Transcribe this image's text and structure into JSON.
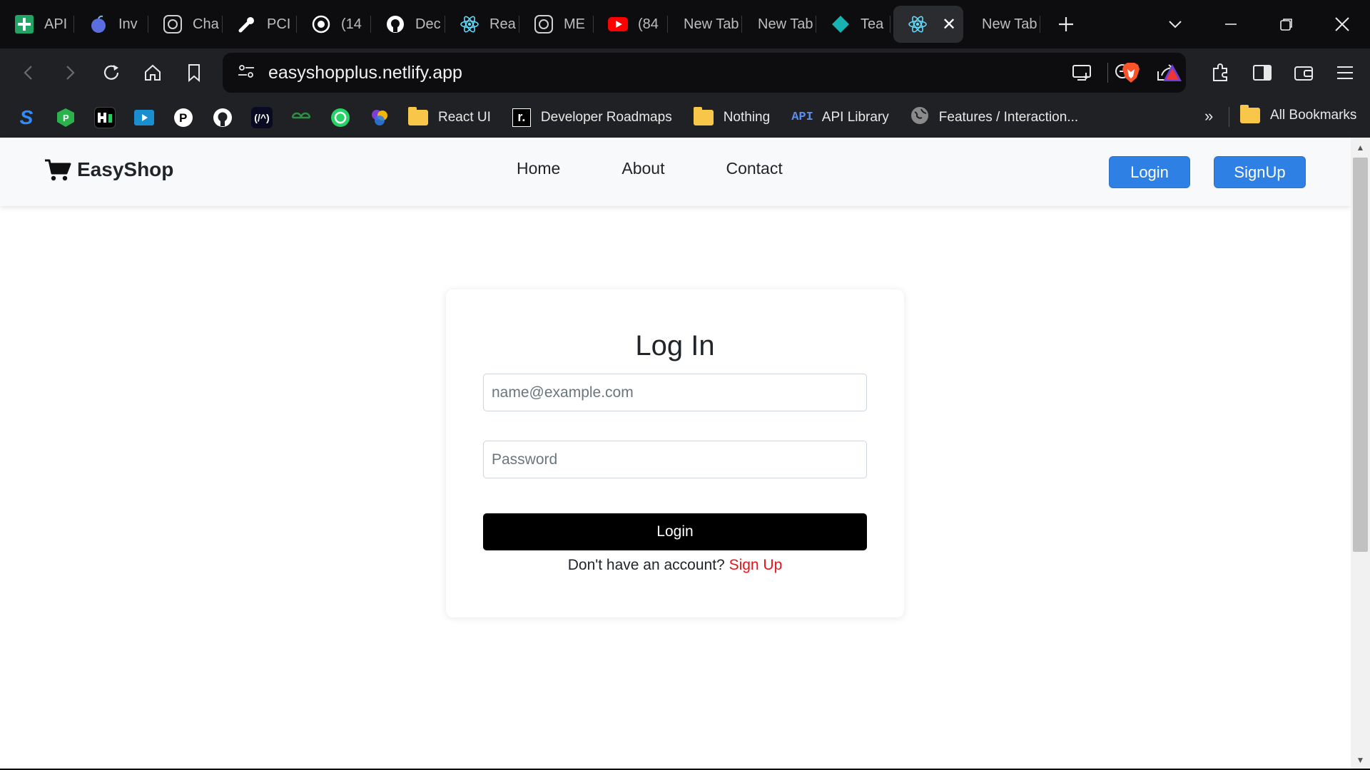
{
  "tabs": [
    {
      "title": "API",
      "icon": "green-plus-icon"
    },
    {
      "title": "Inv",
      "icon": "apple-icon"
    },
    {
      "title": "Cha",
      "icon": "chatgpt-icon"
    },
    {
      "title": "PCI",
      "icon": "postman-icon"
    },
    {
      "title": "(14",
      "icon": "whatsapp-icon"
    },
    {
      "title": "Dec",
      "icon": "github-icon"
    },
    {
      "title": "Rea",
      "icon": "react-icon"
    },
    {
      "title": "ME",
      "icon": "chatgpt-icon"
    },
    {
      "title": "(84",
      "icon": "youtube-icon"
    },
    {
      "title": "New Tab",
      "icon": ""
    },
    {
      "title": "New Tab",
      "icon": ""
    },
    {
      "title": "Tea",
      "icon": "diamond-icon"
    },
    {
      "title": "",
      "icon": "react-icon",
      "active": true
    },
    {
      "title": "New Tab",
      "icon": ""
    }
  ],
  "toolbar": {
    "url": "easyshopplus.netlify.app"
  },
  "bookmarks": {
    "items": [
      {
        "label": "React UI",
        "type": "folder"
      },
      {
        "label": "Developer Roadmaps",
        "type": "site"
      },
      {
        "label": "Nothing",
        "type": "folder"
      },
      {
        "label": "API Library",
        "type": "site",
        "badge": "API"
      },
      {
        "label": "Features / Interaction...",
        "type": "site"
      }
    ],
    "overflow": "»",
    "all_label": "All Bookmarks"
  },
  "navbar": {
    "brand": "EasyShop",
    "links": [
      "Home",
      "About",
      "Contact"
    ],
    "login_label": "Login",
    "signup_label": "SignUp"
  },
  "login_card": {
    "title": "Log In",
    "email_placeholder": "name@example.com",
    "password_placeholder": "Password",
    "submit_label": "Login",
    "prompt": "Don't have an account?",
    "signup_link": "Sign Up"
  },
  "colors": {
    "primary_button": "#2f80e4",
    "submit_button": "#000000",
    "signup_link": "#e8141c"
  }
}
